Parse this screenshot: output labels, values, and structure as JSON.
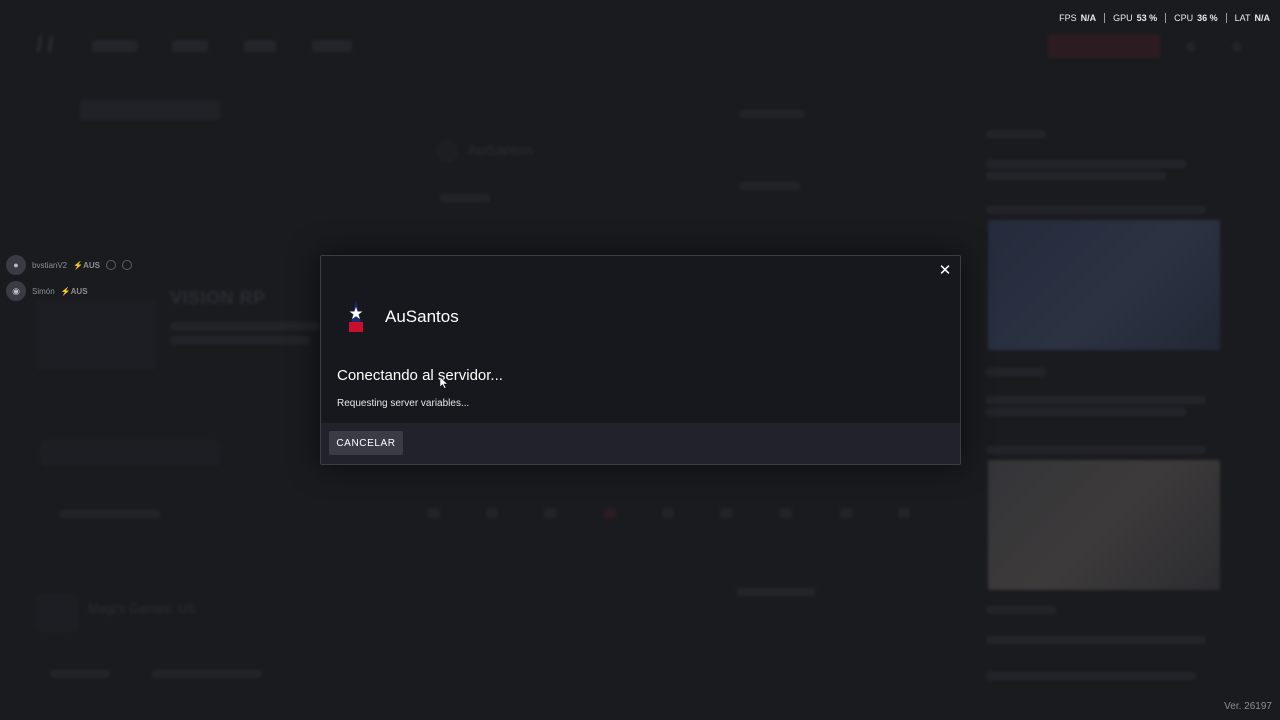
{
  "perf": [
    {
      "label": "FPS",
      "value": "N/A"
    },
    {
      "label": "GPU",
      "value": "53 %"
    },
    {
      "label": "CPU",
      "value": "36 %"
    },
    {
      "label": "LAT",
      "value": "N/A"
    }
  ],
  "presence": [
    {
      "name": "bvstianV2",
      "tag": "⚡AUS"
    },
    {
      "name": "Simón",
      "tag": "⚡AUS"
    }
  ],
  "background": {
    "server_title": "VISION RP",
    "featured_name": "AuSantos",
    "list_item": "Magi's Games: US"
  },
  "dialog": {
    "server_name": "AuSantos",
    "logo_text": "AuSantos",
    "status_title": "Conectando al servidor...",
    "status_sub": "Requesting server variables...",
    "cancel_label": "CANCELAR",
    "close_glyph": "✕"
  },
  "version": "Ver. 26197",
  "colors": {
    "background": "#1a1b1f",
    "dialog_bg": "#17181d",
    "footer_bg": "#22232a",
    "button_bg": "#3b3c43",
    "accent_red": "#3b1e24"
  }
}
